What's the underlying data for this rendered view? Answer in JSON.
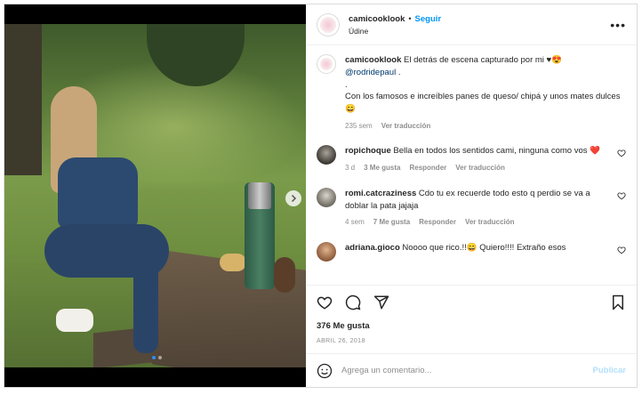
{
  "header": {
    "username": "camicooklook",
    "separator": "•",
    "follow_label": "Seguir",
    "location": "Údine",
    "more_icon": "•••"
  },
  "caption": {
    "username": "camicooklook",
    "text_1": "El detrás de escena capturado por mi",
    "heart": "♥",
    "emoji_1": "😍",
    "mention": "@rodridepaul",
    "text_2": " .",
    "dot_line": ".",
    "text_3": "Con los famosos e increíbles panes de queso/ chipá y unos mates dulces",
    "emoji_2": "😄",
    "age": "235 sem",
    "see_translation": "Ver traducción"
  },
  "comments": [
    {
      "username": "ropichoque",
      "text": "Bella en todos los sentidos cami, ninguna como vos",
      "emoji": "❤️",
      "age": "3 d",
      "likes": "3 Me gusta",
      "reply": "Responder",
      "see_translation": "Ver traducción"
    },
    {
      "username": "romi.catcraziness",
      "text": "Cdo tu ex recuerde todo esto q perdio se va a doblar la pata jajaja",
      "age": "4 sem",
      "likes": "7 Me gusta",
      "reply": "Responder",
      "see_translation": "Ver traducción"
    },
    {
      "username": "adriana.gioco",
      "text": "Noooo que rico.!!",
      "emoji": "😄",
      "text_2": " Quiero!!!! Extraño esos"
    }
  ],
  "actions": {
    "likes": "376 Me gusta",
    "date": "ABRIL 26, 2018"
  },
  "add_comment": {
    "placeholder": "Agrega un comentario...",
    "publish_label": "Publicar"
  },
  "colors": {
    "accent": "#0095f6",
    "publish_disabled": "#b2dffc",
    "muted": "#8e8e8e"
  }
}
